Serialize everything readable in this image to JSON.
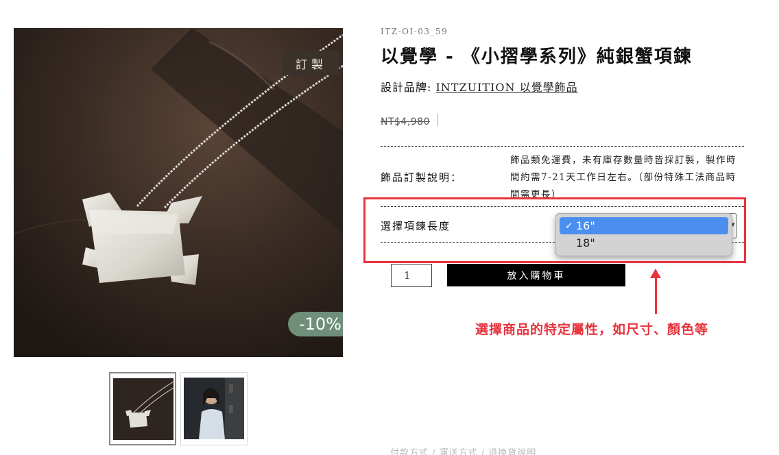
{
  "product": {
    "sku": "ITZ-OI-03_59",
    "title": "以覺學 - 《小摺學系列》純銀蟹項鍊",
    "brand_prefix": "設計品牌: ",
    "brand_name": "INTZUITION 以覺學飾品",
    "old_price": "NT$4,980"
  },
  "image": {
    "custom_badge": "訂製",
    "discount_badge": "-10%"
  },
  "custom_note": {
    "label": "飾品訂製說明：",
    "text": "飾品類免運費，未有庫存數量時皆採訂製，製作時間約需7-21天工作日左右。（部份特殊工法商品時間需更長）"
  },
  "length_select": {
    "label": "選擇項鍊長度",
    "options": [
      {
        "label": "16\"",
        "check": "✓",
        "selected": true
      },
      {
        "label": "18\"",
        "check": "",
        "selected": false
      }
    ]
  },
  "purchase": {
    "quantity": "1",
    "add_to_cart": "放入購物車"
  },
  "annotation": {
    "text": "選擇商品的特定屬性，如尺寸、顏色等"
  },
  "footer": {
    "faded_text": "付款方式 / 運送方式 / 退換貨說明"
  },
  "colors": {
    "accent_red": "#e8333d",
    "discount_green": "#6f8f7a",
    "select_blue": "#4a8ff0",
    "cart_button": "#000000"
  }
}
